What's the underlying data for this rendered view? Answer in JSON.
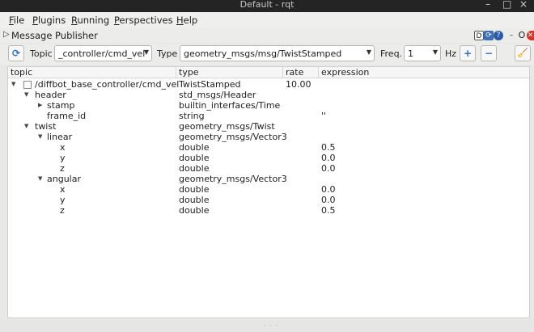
{
  "window": {
    "title": "Default - rqt",
    "minimize": "–",
    "maximize": "□",
    "close": "×"
  },
  "menu": [
    {
      "pre": "",
      "acc": "F",
      "post": "ile"
    },
    {
      "pre": "",
      "acc": "P",
      "post": "lugins"
    },
    {
      "pre": "",
      "acc": "R",
      "post": "unning"
    },
    {
      "pre": "",
      "acc": "P",
      "post": "erspectives"
    },
    {
      "pre": "",
      "acc": "H",
      "post": "elp"
    }
  ],
  "plugin": {
    "name": "Message Publisher",
    "icons": {
      "d": "D",
      "reload": "⟳",
      "help": "?",
      "minus": "–",
      "o": "O",
      "close": "✕"
    }
  },
  "toolbar": {
    "refresh_icon": "⟳",
    "topic_label": "Topic",
    "topic_value": "_controller/cmd_vel",
    "type_label": "Type",
    "type_value": "geometry_msgs/msg/TwistStamped",
    "freq_label": "Freq.",
    "freq_value": "1",
    "hz_label": "Hz",
    "add_icon": "+",
    "remove_icon": "−",
    "clean_icon": "🧹"
  },
  "tree": {
    "headers": {
      "topic": "topic",
      "type": "type",
      "rate": "rate",
      "expression": "expression"
    },
    "rows": [
      {
        "topic": "/diffbot_base_controller/cmd_vel",
        "type": "TwistStamped",
        "rate": "10.00",
        "expression": ""
      },
      {
        "topic": "header",
        "type": "std_msgs/Header",
        "rate": "",
        "expression": ""
      },
      {
        "topic": "stamp",
        "type": "builtin_interfaces/Time",
        "rate": "",
        "expression": ""
      },
      {
        "topic": "frame_id",
        "type": "string",
        "rate": "",
        "expression": "''"
      },
      {
        "topic": "twist",
        "type": "geometry_msgs/Twist",
        "rate": "",
        "expression": ""
      },
      {
        "topic": "linear",
        "type": "geometry_msgs/Vector3",
        "rate": "",
        "expression": ""
      },
      {
        "topic": "x",
        "type": "double",
        "rate": "",
        "expression": "0.5"
      },
      {
        "topic": "y",
        "type": "double",
        "rate": "",
        "expression": "0.0"
      },
      {
        "topic": "z",
        "type": "double",
        "rate": "",
        "expression": "0.0"
      },
      {
        "topic": "angular",
        "type": "geometry_msgs/Vector3",
        "rate": "",
        "expression": ""
      },
      {
        "topic": "x",
        "type": "double",
        "rate": "",
        "expression": "0.0"
      },
      {
        "topic": "y",
        "type": "double",
        "rate": "",
        "expression": "0.0"
      },
      {
        "topic": "z",
        "type": "double",
        "rate": "",
        "expression": "0.5"
      }
    ]
  },
  "statusbar": {
    "grip": "· · ·"
  }
}
